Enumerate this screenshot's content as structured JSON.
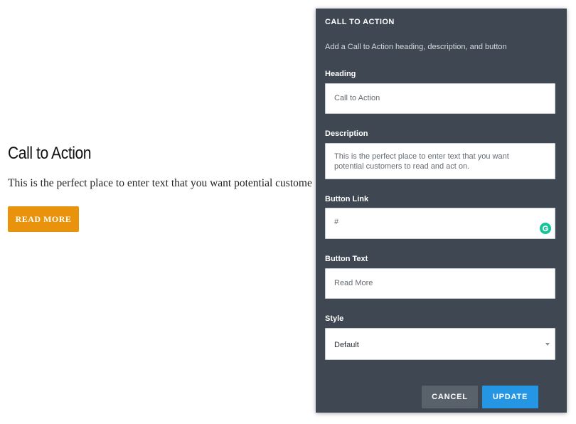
{
  "page": {
    "heading": "Call to Action",
    "description": "This is the perfect place to enter text that you want potential custome",
    "button_label": "READ MORE"
  },
  "panel": {
    "title": "CALL TO ACTION",
    "subtitle": "Add a Call to Action heading, description, and button",
    "fields": {
      "heading": {
        "label": "Heading",
        "value": "Call to Action"
      },
      "description": {
        "label": "Description",
        "value": "This is the perfect place to enter text that you want potential customers to read and act on."
      },
      "button_link": {
        "label": "Button Link",
        "value": "#"
      },
      "button_text": {
        "label": "Button Text",
        "value": "Read More"
      },
      "style": {
        "label": "Style",
        "value": "Default"
      }
    },
    "actions": {
      "cancel_label": "CANCEL",
      "update_label": "UPDATE"
    }
  },
  "colors": {
    "panel_bg": "#3f4852",
    "cta_button": "#e8930b",
    "update_button": "#2496e3",
    "cancel_button": "#59616b",
    "grammarly": "#15c39a"
  },
  "icons": {
    "grammarly": "grammarly-icon",
    "select_arrow": "chevron-down-icon"
  }
}
